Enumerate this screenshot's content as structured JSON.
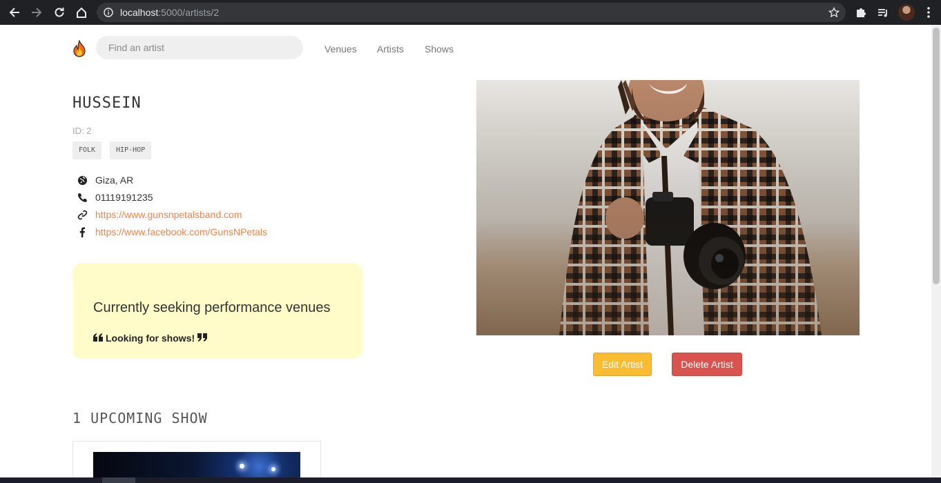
{
  "browser": {
    "url_host": "localhost",
    "url_path": ":5000/artists/2"
  },
  "header": {
    "search_placeholder": "Find an artist",
    "nav": [
      {
        "label": "Venues"
      },
      {
        "label": "Artists"
      },
      {
        "label": "Shows"
      }
    ]
  },
  "artist": {
    "name": "HUSSEIN",
    "id_text": "ID: 2",
    "genres": [
      "FOLK",
      "HIP-HOP"
    ],
    "location": "Giza, AR",
    "phone": "01119191235",
    "website": "https://www.gunsnpetalsband.com",
    "facebook": "https://www.facebook.com/GunsNPetals",
    "seeking_title": "Currently seeking performance venues",
    "seeking_description": "Looking for shows!"
  },
  "actions": {
    "edit_label": "Edit Artist",
    "delete_label": "Delete Artist"
  },
  "shows": {
    "upcoming_heading": "1 UPCOMING SHOW"
  },
  "colors": {
    "link": "#f0824a",
    "seeking_bg": "#fffcc9",
    "edit_button": "#fbbc31",
    "delete_button": "#d9534f"
  }
}
